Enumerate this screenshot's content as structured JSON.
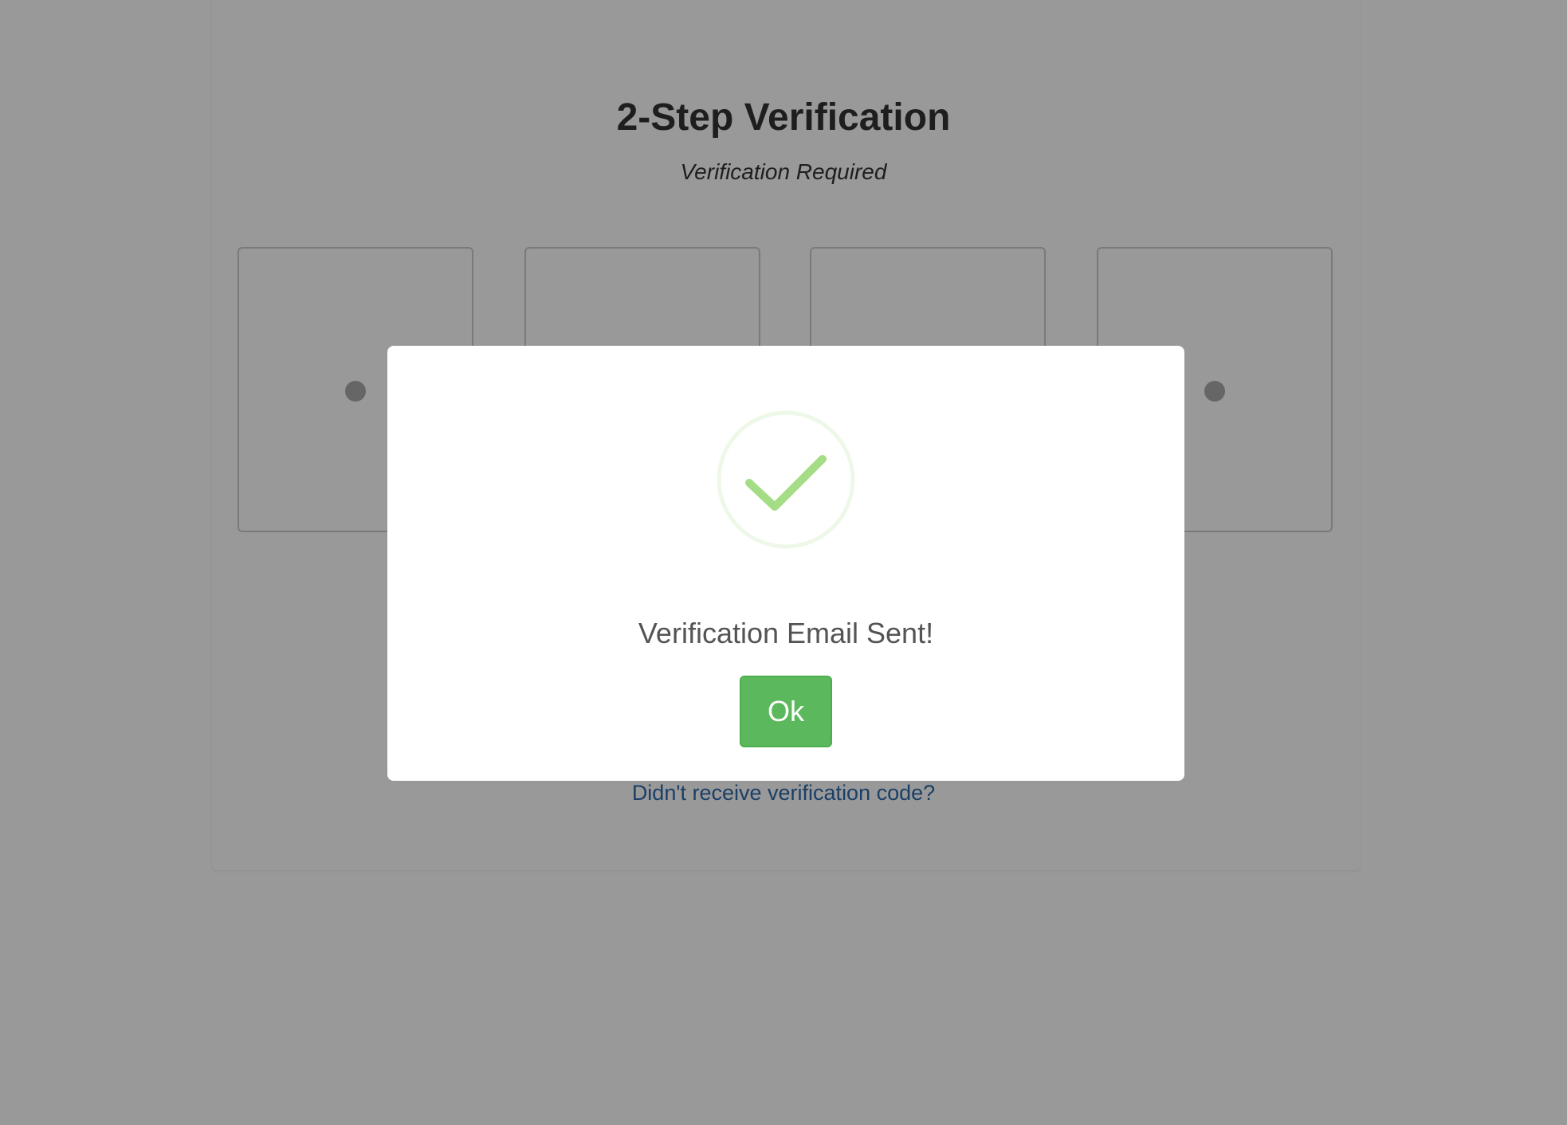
{
  "page": {
    "title": "2-Step Verification",
    "subtitle": "Verification Required",
    "resend_link": "Didn't receive verification code?",
    "edge_glyph": ":"
  },
  "code_inputs": [
    {
      "state": "filled"
    },
    {
      "state": "obscured"
    },
    {
      "state": "obscured"
    },
    {
      "state": "filled"
    }
  ],
  "modal": {
    "icon": "checkmark-icon",
    "message": "Verification Email Sent!",
    "ok_label": "Ok",
    "colors": {
      "ok_button": "#5cb85c",
      "check": "#a5dc86",
      "check_ring": "#eef8e8"
    }
  },
  "colors": {
    "overlay_bg": "#999999",
    "link": "#1b3f66"
  }
}
